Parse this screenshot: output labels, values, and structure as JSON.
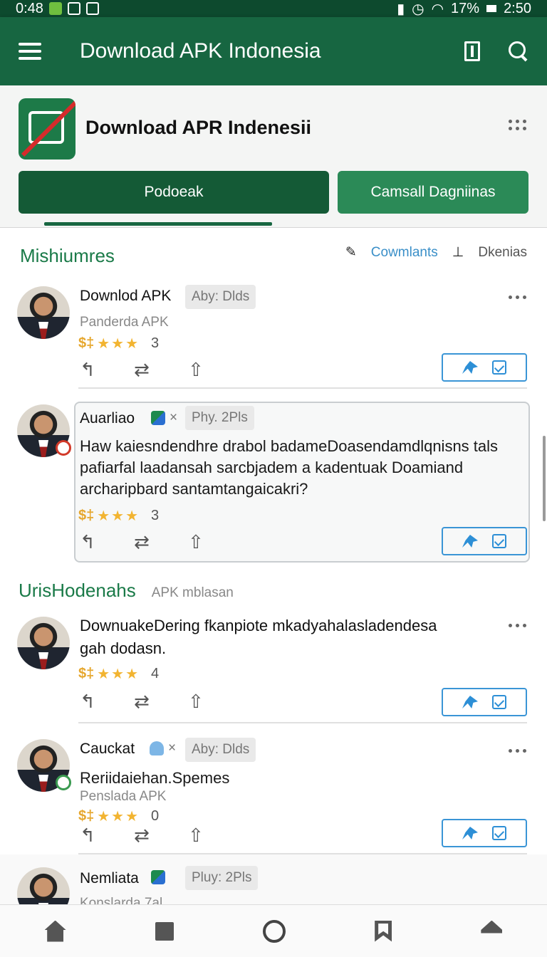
{
  "status_bar": {
    "time": "0:48",
    "battery": "17%",
    "clock": "2:50"
  },
  "app_bar": {
    "title": "Download APK Indonesia",
    "icons": [
      "menu-icon",
      "bookmark-icon",
      "search-icon"
    ]
  },
  "header": {
    "app_name": "Download APR Indenesii",
    "primary_button": "Podoeak",
    "secondary_button": "Camsall Dagniinas"
  },
  "section1": {
    "title": "Mishiumres",
    "filter1": "Cowmlants",
    "filter2": "Dkenias"
  },
  "posts": [
    {
      "author": "Downlod APK",
      "tag": "Aby: Dlds",
      "subtitle": "Panderda APK",
      "currency": "$‡",
      "stars": "★★★",
      "count": "3"
    },
    {
      "author": "Auarliao",
      "tag": "Phy. 2Pls",
      "mini_close": "×",
      "body": "Haw kaiesndendhre drabol badameDoasendamdlqnisns tals pafiarfal laadansah sarcbjadem a kadentuak Doamiand archaripbard santamtangaicakri?",
      "currency": "$‡",
      "stars": "★★★",
      "count": "3"
    },
    {
      "author": "DownuakeDering fkanpiote mkadyahalasladendesa",
      "author2": "gah dodasn.",
      "currency": "$‡",
      "stars": "★★★",
      "count": "4"
    },
    {
      "author": "Cauckat",
      "tag": "Aby: Dlds",
      "mini_close": "×",
      "body": "Reriidaiehan.Spemes",
      "subtitle": "Penslada APK",
      "currency": "$‡",
      "stars": "★★★",
      "count": "0"
    },
    {
      "author": "Nemliata",
      "tag": "Pluy: 2Pls",
      "subtitle": "Konslarda 7al"
    }
  ],
  "section2": {
    "title": "UrisHodenahs",
    "subtitle": "APK mblasan"
  },
  "nav_icons": [
    "home-icon",
    "square-icon",
    "circle-icon",
    "bookmark-icon",
    "upload-icon"
  ]
}
